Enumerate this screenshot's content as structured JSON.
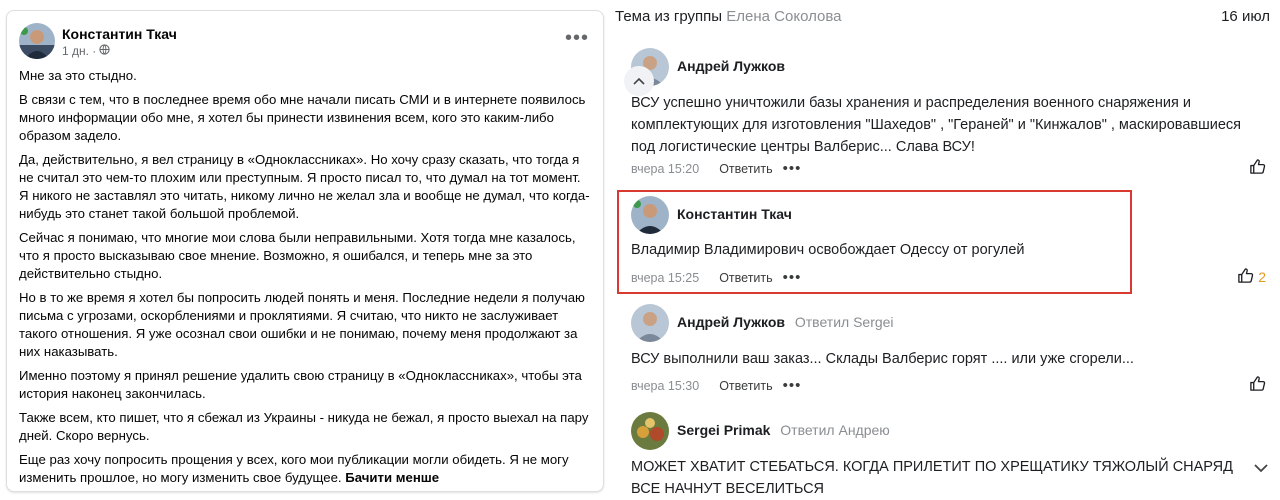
{
  "post": {
    "author": "Константин Ткач",
    "time": "1 дн. ·",
    "paragraphs": [
      "Мне за это стыдно.",
      "В связи с тем, что в последнее время обо мне начали писать СМИ и в интернете появилось много информации обо мне, я хотел бы принести извинения всем, кого это каким-либо образом задело.",
      "Да, действительно, я вел страницу в «Одноклассниках». Но хочу сразу сказать, что тогда я не считал это чем-то плохим или преступным. Я просто писал то, что думал на тот момент. Я никого не заставлял это читать, никому лично не желал зла и вообще не думал, что когда-нибудь это станет такой большой проблемой.",
      "Сейчас я понимаю, что многие мои слова были неправильными. Хотя тогда мне казалось, что я просто высказываю свое мнение. Возможно, я ошибался, и теперь мне за это действительно стыдно.",
      "Но в то же время я хотел бы попросить людей понять и меня. Последние недели я получаю письма с угрозами, оскорблениями и проклятиями. Я считаю, что никто не заслуживает такого отношения. Я уже осознал свои ошибки и не понимаю, почему меня продолжают за них наказывать.",
      "Именно поэтому я принял решение удалить свою страницу в «Одноклассниках», чтобы эта история наконец закончилась.",
      "Также всем, кто пишет, что я сбежал из Украины - никуда не бежал, я просто выехал на пару дней. Скоро вернусь."
    ],
    "last_paragraph": "Еще раз хочу попросить прощения у всех, кого мои публикации могли обидеть. Я не могу изменить прошлое, но могу изменить свое будущее.",
    "read_less": "Бачити менше",
    "icons": {
      "globe": "globe-icon",
      "more": "more-horizontal-icon"
    }
  },
  "thread": {
    "prefix": "Тема из группы",
    "group": "Елена Соколова",
    "date": "16 июл",
    "reply_label": "Ответить",
    "comments": [
      {
        "author": "Андрей Лужков",
        "reply_to": "",
        "text": "ВСУ успешно уничтожили базы хранения и распределения военного снаряжения и комплектующих для изготовления \"Шахедов\" , \"Гераней\" и \"Кинжалов\" , маскировавшиеся под логистические центры Валберис... Слава ВСУ!",
        "time": "вчера 15:20",
        "likes": ""
      },
      {
        "author": "Константин Ткач",
        "reply_to": "",
        "text": "Владимир Владимирович освобождает Одессу от рогулей",
        "time": "вчера 15:25",
        "likes": "2"
      },
      {
        "author": "Андрей Лужков",
        "reply_to": "Ответил Sergei",
        "text": "ВСУ выполнили ваш заказ... Склады Валберис горят .... или уже сгорели...",
        "time": "вчера 15:30",
        "likes": ""
      },
      {
        "author": "Sergei Primak",
        "reply_to": "Ответил Андрею",
        "text": "МОЖЕТ ХВАТИТ СТЕБАТЬСЯ. КОГДА ПРИЛЕТИТ ПО ХРЕЩАТИКУ ТЯЖОЛЫЙ СНАРЯД ВСЕ НАЧНУТ ВЕСЕЛИТЬСЯ",
        "time": "",
        "likes": ""
      }
    ]
  },
  "colors": {
    "highlight": "#d93a30",
    "like_count": "#e79a1a",
    "muted": "#8a8d91"
  }
}
